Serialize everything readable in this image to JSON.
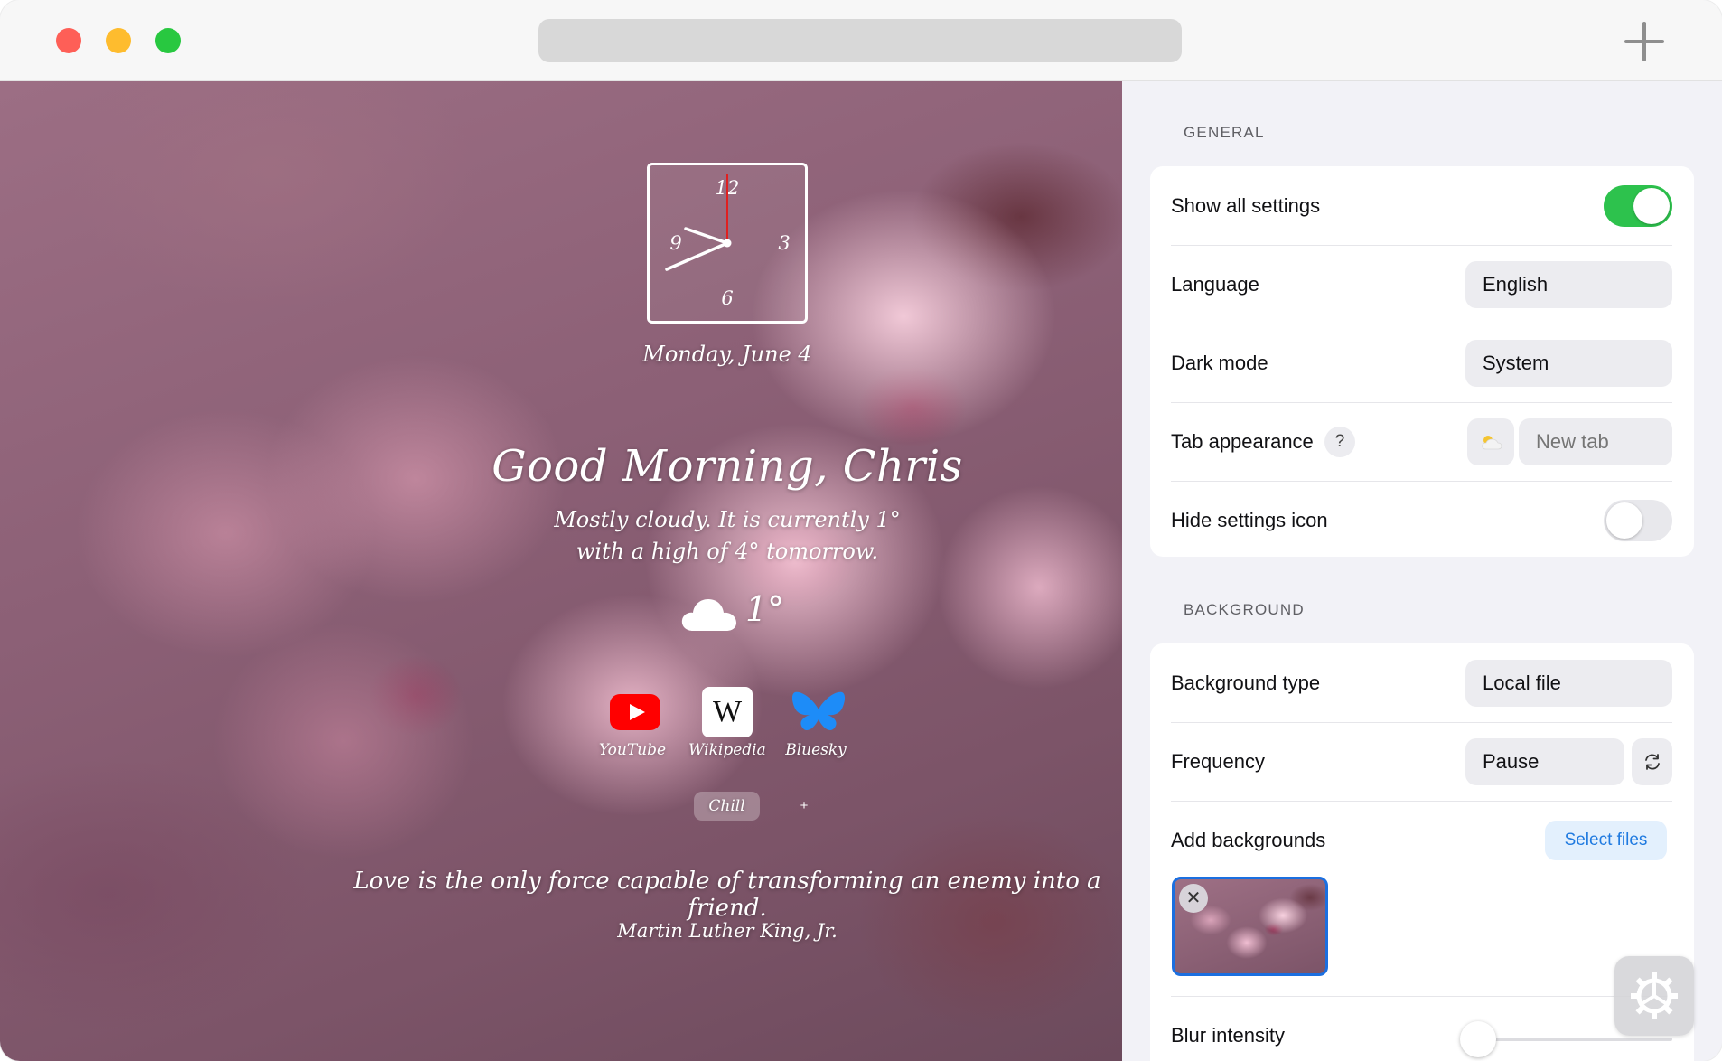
{
  "titlebar": {
    "url_text": "",
    "new_tab_icon": "plus-icon"
  },
  "newtab": {
    "clock": {
      "numerals": [
        "12",
        "3",
        "6",
        "9"
      ]
    },
    "date": "Monday, June 4",
    "greeting": "Good Morning, Chris",
    "weather": {
      "line1": "Mostly cloudy. It is currently 1°",
      "line2": "with a high of 4° tomorrow.",
      "icon": "cloud-icon",
      "temperature": "1°"
    },
    "links": [
      {
        "label": "YouTube",
        "icon": "youtube-icon"
      },
      {
        "label": "Wikipedia",
        "icon": "wikipedia-icon",
        "glyph": "W"
      },
      {
        "label": "Bluesky",
        "icon": "bluesky-icon"
      }
    ],
    "groups": {
      "active": "Chill",
      "add": "+"
    },
    "quote": "Love is the only force capable of transforming an enemy into a friend.",
    "author": "Martin Luther King, Jr."
  },
  "settings": {
    "general": {
      "title": "GENERAL",
      "show_all": {
        "label": "Show all settings",
        "enabled": true
      },
      "language": {
        "label": "Language",
        "value": "English"
      },
      "dark_mode": {
        "label": "Dark mode",
        "value": "System"
      },
      "tab_appearance": {
        "label": "Tab appearance",
        "help": "?",
        "emoji_icon": "sun-cloud-icon",
        "placeholder": "New tab"
      },
      "hide_icon": {
        "label": "Hide settings icon",
        "enabled": false
      }
    },
    "background": {
      "title": "BACKGROUND",
      "type": {
        "label": "Background type",
        "value": "Local file"
      },
      "frequency": {
        "label": "Frequency",
        "value": "Pause",
        "refresh_icon": "refresh-icon"
      },
      "add": {
        "label": "Add backgrounds",
        "button": "Select files",
        "remove_glyph": "✕"
      },
      "blur": {
        "label": "Blur intensity",
        "level": 0
      }
    },
    "fab_icon": "gear-icon"
  },
  "colors": {
    "toggle_on": "#2dc24d",
    "accent_blue": "#1f7ae0",
    "youtube_red": "#ff0000",
    "bluesky_blue": "#1d8cf8",
    "clock_second_hand": "#e02020"
  }
}
